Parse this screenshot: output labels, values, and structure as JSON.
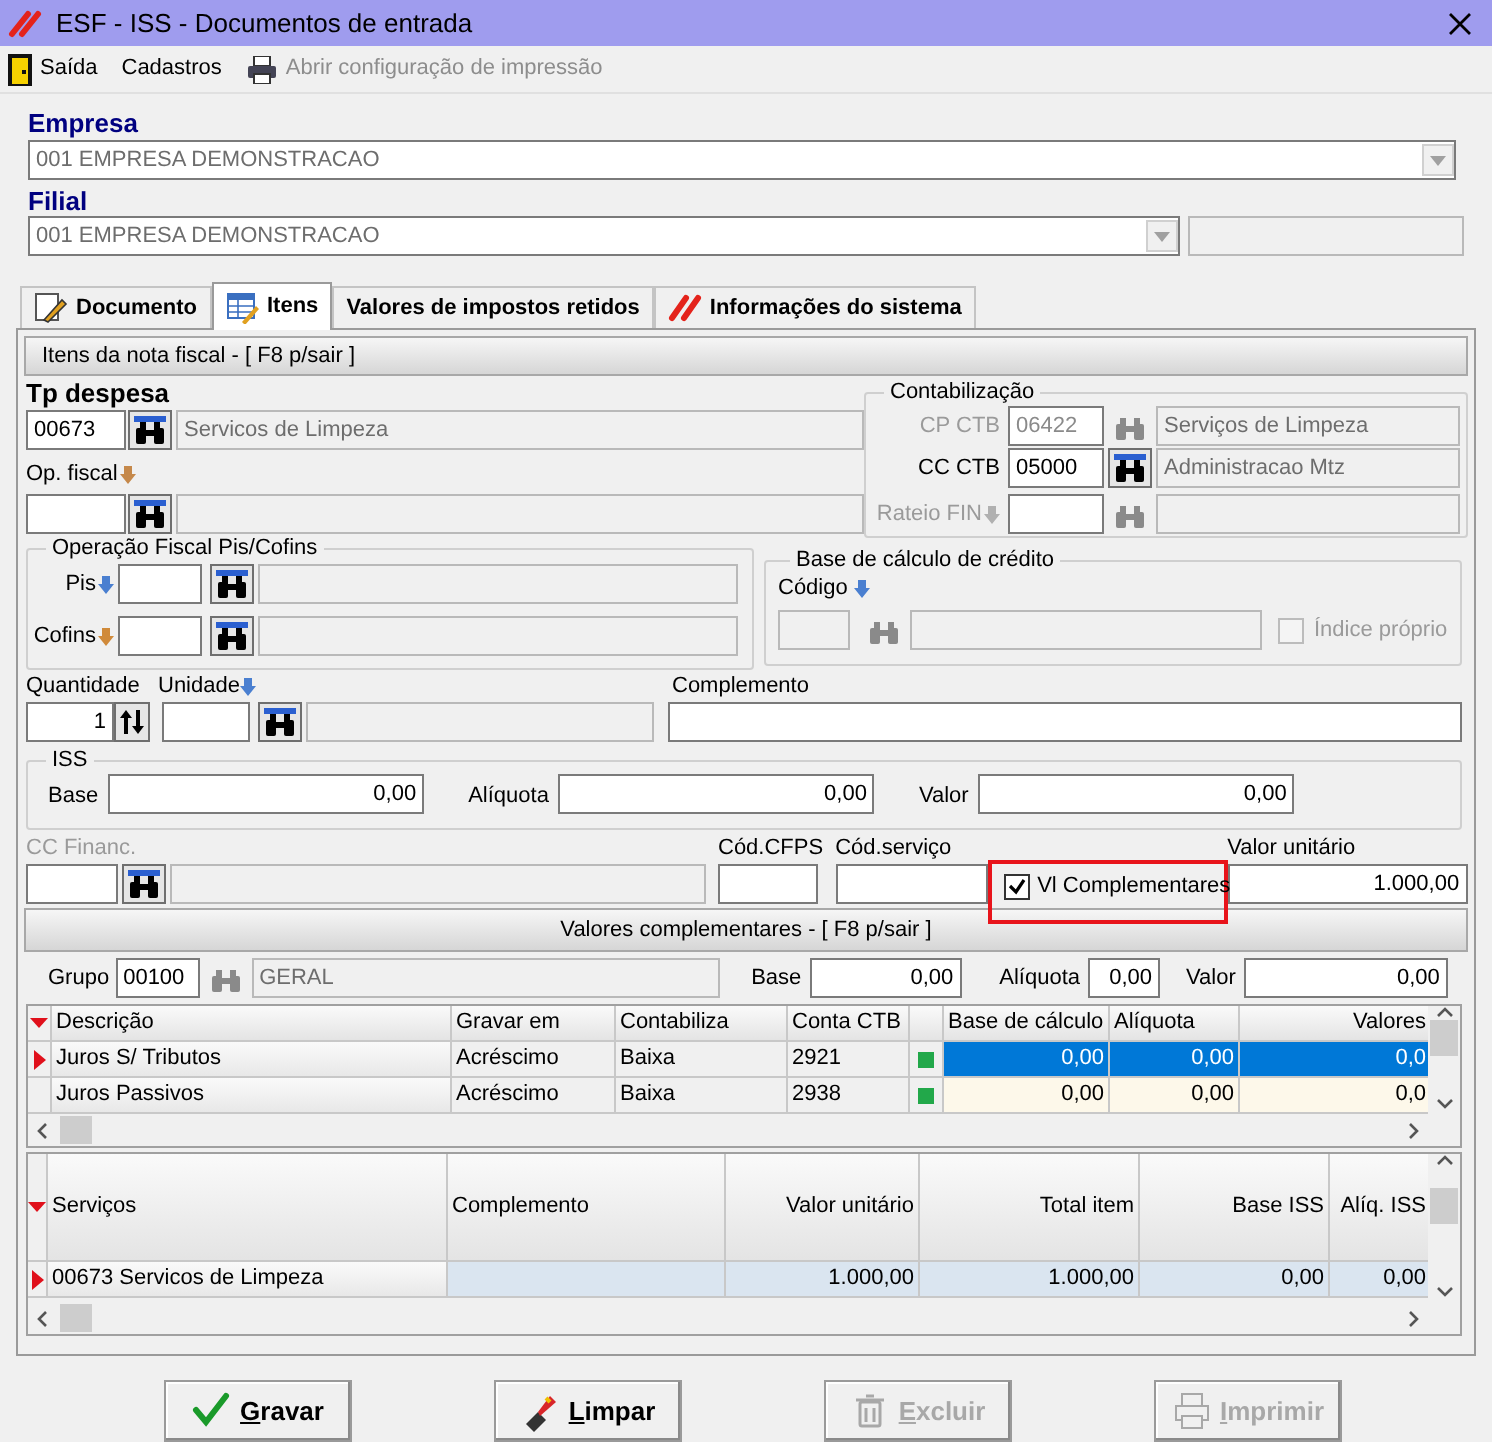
{
  "window": {
    "title": "ESF - ISS - Documentos de entrada"
  },
  "menu": [
    {
      "label": "Saída",
      "disabled": false
    },
    {
      "label": "Cadastros",
      "disabled": false
    },
    {
      "label": "Abrir configuração de impressão",
      "disabled": true
    }
  ],
  "empresa": {
    "label": "Empresa",
    "value": "001 EMPRESA DEMONSTRACAO"
  },
  "filial": {
    "label": "Filial",
    "value": "001 EMPRESA DEMONSTRACAO"
  },
  "tabs": [
    {
      "label": "Documento",
      "selected": false
    },
    {
      "label": "Itens",
      "selected": true
    },
    {
      "label": "Valores de impostos retidos",
      "selected": false
    },
    {
      "label": "Informações do sistema",
      "selected": false
    }
  ],
  "section_title": "Itens da nota fiscal - [ F8 p/sair ]",
  "tp_despesa": {
    "label": "Tp despesa",
    "code": "00673",
    "description": "Servicos de Limpeza"
  },
  "op_fiscal": {
    "label": "Op. fiscal"
  },
  "contabilizacao": {
    "title": "Contabilização",
    "rows": [
      {
        "label": "CP CTB",
        "code": "06422",
        "description": "Serviços de Limpeza",
        "disabled": true
      },
      {
        "label": "CC CTB",
        "code": "05000",
        "description": "Administracao Mtz",
        "disabled": false
      },
      {
        "label": "Rateio FIN",
        "disabled": true
      }
    ]
  },
  "pis_cofins": {
    "title": "Operação Fiscal Pis/Cofins",
    "rows": [
      {
        "label": "Pis"
      },
      {
        "label": "Cofins"
      }
    ]
  },
  "base_credito": {
    "title": "Base de cálculo de crédito",
    "codigo_label": "Código",
    "indice_proprio": {
      "label": "Índice próprio",
      "checked": false,
      "disabled": true
    }
  },
  "quantidade": {
    "label": "Quantidade",
    "value": "1"
  },
  "unidade": {
    "label": "Unidade"
  },
  "complemento": {
    "label": "Complemento"
  },
  "iss": {
    "title": "ISS",
    "fields": [
      {
        "label": "Base",
        "value": "0,00"
      },
      {
        "label": "Alíquota",
        "value": "0,00"
      },
      {
        "label": "Valor",
        "value": "0,00"
      }
    ]
  },
  "cc_financ": {
    "label": "CC Financ.",
    "disabled": true
  },
  "cod_cfps": {
    "label": "Cód.CFPS"
  },
  "cod_servico": {
    "label": "Cód.serviço"
  },
  "vl_complementares": {
    "label": "Vl Complementares",
    "checked": true,
    "highlighted": true
  },
  "valor_unitario": {
    "label": "Valor unitário",
    "value": "1.000,00"
  },
  "complementares": {
    "title": "Valores complementares - [ F8 p/sair ]",
    "grupo": {
      "label": "Grupo",
      "code": "00100",
      "description": "GERAL"
    },
    "totals": [
      {
        "label": "Base",
        "value": "0,00"
      },
      {
        "label": "Alíquota",
        "value": "0,00"
      },
      {
        "label": "Valor",
        "value": "0,00"
      }
    ],
    "table": {
      "columns": [
        "Descrição",
        "Gravar em",
        "Contabiliza",
        "Conta CTB",
        "Base de cálculo",
        "Alíquota",
        "Valores"
      ],
      "rows": [
        {
          "selected": true,
          "flag": true,
          "cells": [
            "Juros S/ Tributos",
            "Acréscimo",
            "Baixa",
            "2921",
            "0,00",
            "0,00",
            "0,0"
          ]
        },
        {
          "selected": false,
          "flag": true,
          "cells": [
            "Juros Passivos",
            "Acréscimo",
            "Baixa",
            "2938",
            "0,00",
            "0,00",
            "0,0"
          ]
        }
      ]
    }
  },
  "servicos_table": {
    "columns": [
      "Serviços",
      "Complemento",
      "Valor unitário",
      "Total item",
      "Base ISS",
      "Alíq. ISS"
    ],
    "rows": [
      {
        "selected": true,
        "servico": "00673 Servicos de Limpeza",
        "valor_unitario": "1.000,00",
        "total_item": "1.000,00",
        "base_iss": "0,00",
        "aliq_iss": "0,00"
      }
    ]
  },
  "buttons": [
    {
      "kind": "save",
      "label": "Gravar",
      "disabled": false
    },
    {
      "kind": "clear",
      "label": "Limpar",
      "disabled": false
    },
    {
      "kind": "delete",
      "label": "Excluir",
      "disabled": true
    },
    {
      "kind": "print",
      "label": "Imprimir",
      "disabled": true
    }
  ]
}
